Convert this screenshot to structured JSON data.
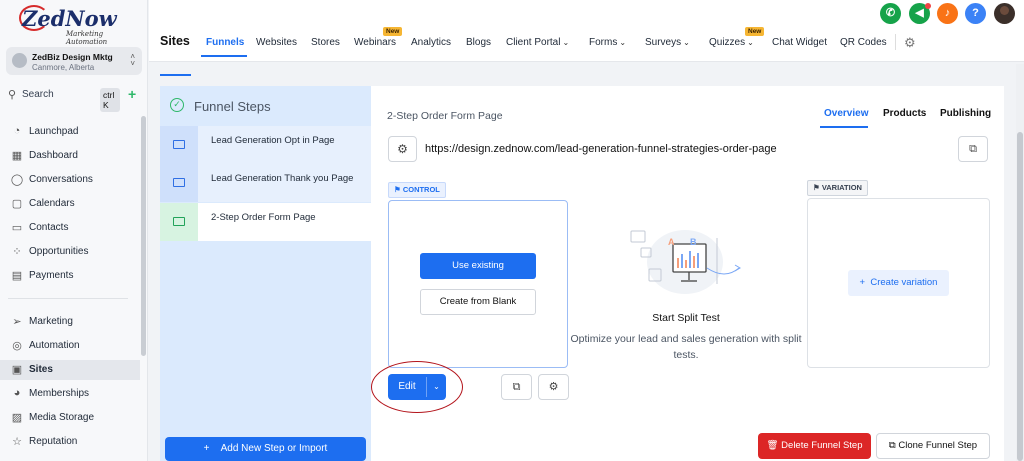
{
  "brand": {
    "logo_main": "ZedNow",
    "logo_sub": "Marketing Automation"
  },
  "account": {
    "name": "ZedBiz Design Mktg",
    "location": "Canmore, Alberta"
  },
  "search": {
    "label": "Search",
    "shortcut": "ctrl K"
  },
  "sidebar": {
    "items": [
      {
        "label": "Launchpad",
        "icon": "rocket-icon"
      },
      {
        "label": "Dashboard",
        "icon": "dashboard-icon"
      },
      {
        "label": "Conversations",
        "icon": "chat-icon"
      },
      {
        "label": "Calendars",
        "icon": "calendar-icon"
      },
      {
        "label": "Contacts",
        "icon": "contacts-icon"
      },
      {
        "label": "Opportunities",
        "icon": "opportunities-icon"
      },
      {
        "label": "Payments",
        "icon": "payments-icon"
      },
      {
        "label": "Marketing",
        "icon": "send-icon"
      },
      {
        "label": "Automation",
        "icon": "automation-icon"
      },
      {
        "label": "Sites",
        "icon": "sites-icon",
        "active": true
      },
      {
        "label": "Memberships",
        "icon": "memberships-icon"
      },
      {
        "label": "Media Storage",
        "icon": "media-icon"
      },
      {
        "label": "Reputation",
        "icon": "star-icon"
      }
    ]
  },
  "header": {
    "title": "Sites",
    "tabs": [
      {
        "label": "Funnels",
        "active": true
      },
      {
        "label": "Websites"
      },
      {
        "label": "Stores"
      },
      {
        "label": "Webinars",
        "badge": "New"
      },
      {
        "label": "Analytics"
      },
      {
        "label": "Blogs"
      },
      {
        "label": "Client Portal",
        "dropdown": true
      },
      {
        "label": "Forms",
        "dropdown": true
      },
      {
        "label": "Surveys",
        "dropdown": true
      },
      {
        "label": "Quizzes",
        "dropdown": true,
        "badge": "New"
      },
      {
        "label": "Chat Widget"
      },
      {
        "label": "QR Codes"
      }
    ],
    "quick_actions": {
      "phone_color": "#16a34a",
      "megaphone_color": "#16a34a",
      "bell_color": "#f97316",
      "help_label": "?",
      "help_color": "#3b82f6"
    }
  },
  "funnel_steps": {
    "title": "Funnel Steps",
    "steps": [
      {
        "label": "Lead Generation Opt in Page"
      },
      {
        "label": "Lead Generation Thank you Page"
      },
      {
        "label": "2-Step Order Form Page",
        "active": true
      }
    ],
    "add_button": "Add New Step or Import"
  },
  "page": {
    "title": "2-Step Order Form Page",
    "tabs": [
      {
        "label": "Overview",
        "active": true
      },
      {
        "label": "Products"
      },
      {
        "label": "Publishing"
      }
    ],
    "url": "https://design.zednow.com/lead-generation-funnel-strategies-order-page",
    "control": {
      "badge": "CONTROL",
      "use_existing": "Use existing",
      "create_blank": "Create from Blank",
      "edit": "Edit"
    },
    "split_test": {
      "title": "Start Split Test",
      "description": "Optimize your lead and sales generation with split tests.",
      "illus_a": "A",
      "illus_b": "B"
    },
    "variation": {
      "badge": "VARIATION",
      "create": "Create variation"
    },
    "delete_button": "Delete Funnel Step",
    "clone_button": "Clone Funnel Step"
  },
  "colors": {
    "accent": "#1d6ef0",
    "danger": "#dc2626",
    "steps_bg": "#dbeafd",
    "highlight_ring": "#b3141b"
  }
}
